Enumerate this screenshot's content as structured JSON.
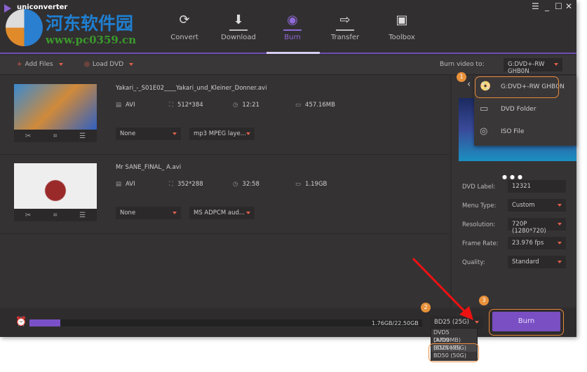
{
  "app": {
    "title": "uniconverter"
  },
  "watermark": {
    "name": "河东软件园",
    "url": "www.pc0359.cn"
  },
  "nav": [
    {
      "label": "Convert",
      "icon": "convert-icon"
    },
    {
      "label": "Download",
      "icon": "download-icon"
    },
    {
      "label": "Burn",
      "icon": "burn-icon",
      "active": true
    },
    {
      "label": "Transfer",
      "icon": "transfer-icon"
    },
    {
      "label": "Toolbox",
      "icon": "toolbox-icon"
    }
  ],
  "toolbar": {
    "add_files": "Add Files",
    "load_dvd": "Load DVD",
    "burn_to_label": "Burn video to:",
    "burn_to_value": "G:DVD+-RW GHB0N"
  },
  "files": [
    {
      "name": "Yakari_-_S01E02____Yakari_und_Kleiner_Donner.avi",
      "format": "AVI",
      "resolution": "512*384",
      "duration": "12:21",
      "size": "457.16MB",
      "subtitle": "None",
      "audio": "mp3 MPEG laye..."
    },
    {
      "name": "Mr SANE_FINAL_ A.avi",
      "format": "AVI",
      "resolution": "352*288",
      "duration": "32:58",
      "size": "1.19GB",
      "subtitle": "None",
      "audio": "MS ADPCM aud..."
    }
  ],
  "burn_menu": [
    {
      "label": "G:DVD+-RW GHB0N",
      "icon": "dvd-icon"
    },
    {
      "label": "DVD Folder",
      "icon": "folder-icon"
    },
    {
      "label": "ISO File",
      "icon": "disc-icon"
    }
  ],
  "settings": {
    "dvd_label": {
      "label": "DVD Label:",
      "value": "12321"
    },
    "menu_type": {
      "label": "Menu Type:",
      "value": "Custom"
    },
    "resolution": {
      "label": "Resolution:",
      "value": "720P (1280*720)"
    },
    "frame_rate": {
      "label": "Frame Rate:",
      "value": "23.976 fps"
    },
    "quality": {
      "label": "Quality:",
      "value": "Standard"
    }
  },
  "bottom": {
    "usage": "1.76GB/22.50GB",
    "usage_fraction": 0.078,
    "disc_type": "BD25 (25G)",
    "disc_options": [
      "DVD5 (4700MB)",
      "DVD9 (8500MB)",
      "BD25 (25G)",
      "BD50 (50G)"
    ],
    "burn_label": "Burn"
  },
  "badges": [
    "1",
    "2",
    "3"
  ],
  "colors": {
    "accent": "#7a4fc4",
    "highlight": "#e88a3a",
    "caret": "#e0604a"
  }
}
